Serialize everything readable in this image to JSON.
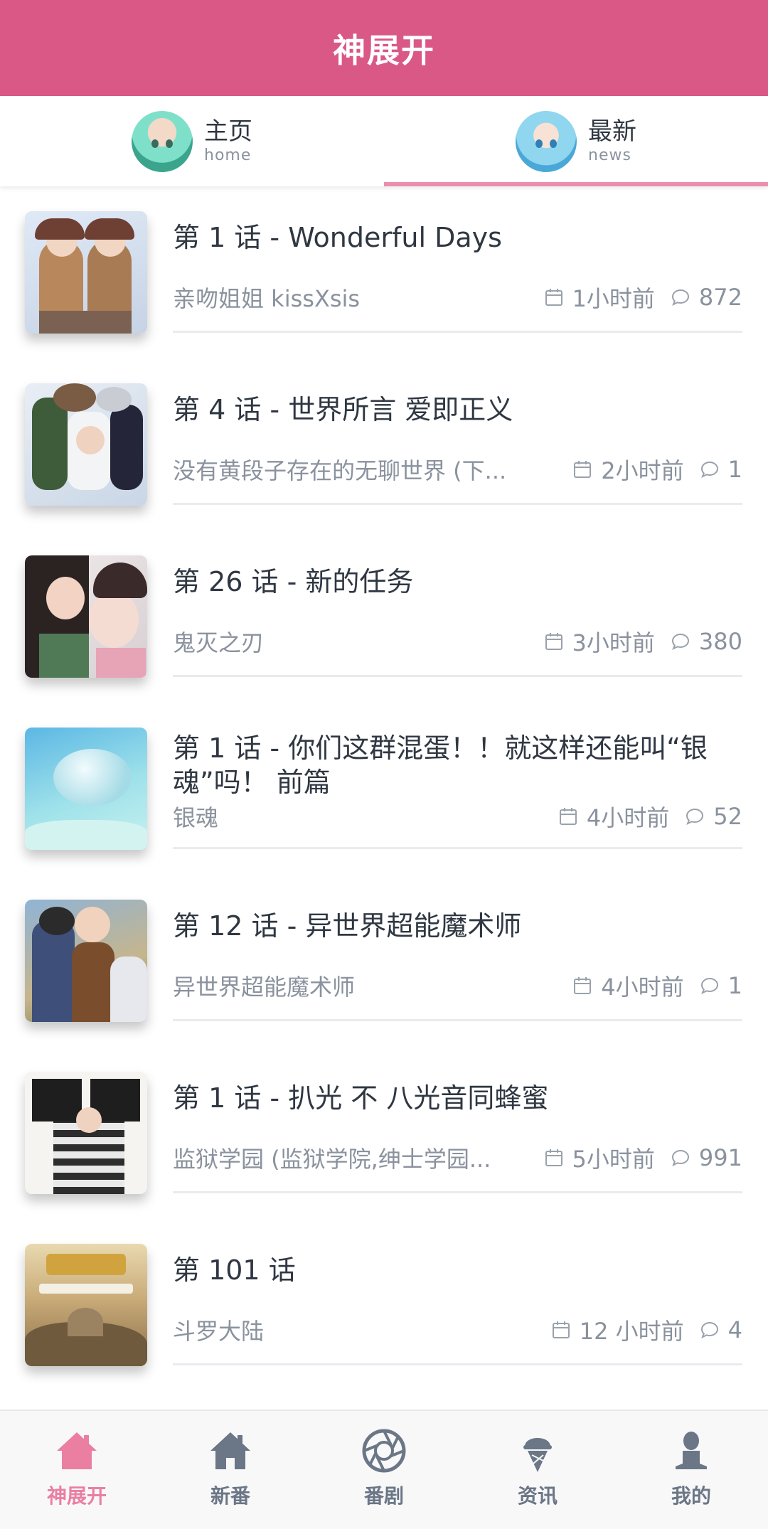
{
  "header": {
    "title": "神展开"
  },
  "tabs": [
    {
      "label": "主页",
      "sub": "home",
      "avatar": "anime-girl-green-avatar",
      "active": false
    },
    {
      "label": "最新",
      "sub": "news",
      "avatar": "anime-girl-blue-avatar",
      "active": true
    }
  ],
  "episodes": [
    {
      "title": "第 1 话 - Wonderful Days",
      "series": "亲吻姐姐 kissXsis",
      "time": "1小时前",
      "comments": "872"
    },
    {
      "title": "第 4 话 - 世界所言 爱即正义",
      "series": "没有黄段子存在的无聊世界 (下...",
      "time": "2小时前",
      "comments": "1"
    },
    {
      "title": "第 26 话 - 新的任务",
      "series": "鬼灭之刃",
      "time": "3小时前",
      "comments": "380"
    },
    {
      "title": "第 1 话 - 你们这群混蛋！！就这样还能叫“银魂”吗！ 前篇",
      "series": "银魂",
      "time": "4小时前",
      "comments": "52"
    },
    {
      "title": "第 12 话 - 异世界超能魔术师",
      "series": "异世界超能魔术师",
      "time": "4小时前",
      "comments": "1"
    },
    {
      "title": "第 1 话 - 扒光 不 八光音同蜂蜜",
      "series": "监狱学园 (监狱学院,绅士学园...",
      "time": "5小时前",
      "comments": "991"
    },
    {
      "title": "第 101 话",
      "series": "斗罗大陆",
      "time": "12 小时前",
      "comments": "4"
    }
  ],
  "bottom_nav": [
    {
      "label": "神展开",
      "icon": "home-icon",
      "active": true
    },
    {
      "label": "新番",
      "icon": "house-icon",
      "active": false
    },
    {
      "label": "番剧",
      "icon": "aperture-icon",
      "active": false
    },
    {
      "label": "资讯",
      "icon": "ice-cream-icon",
      "active": false
    },
    {
      "label": "我的",
      "icon": "user-icon",
      "active": false
    }
  ],
  "colors": {
    "brand": "#d95886",
    "tab_indicator": "#e98fac",
    "nav_active": "#ea7fa2",
    "nav_inactive": "#6b7686",
    "meta_text": "#8a929e"
  }
}
